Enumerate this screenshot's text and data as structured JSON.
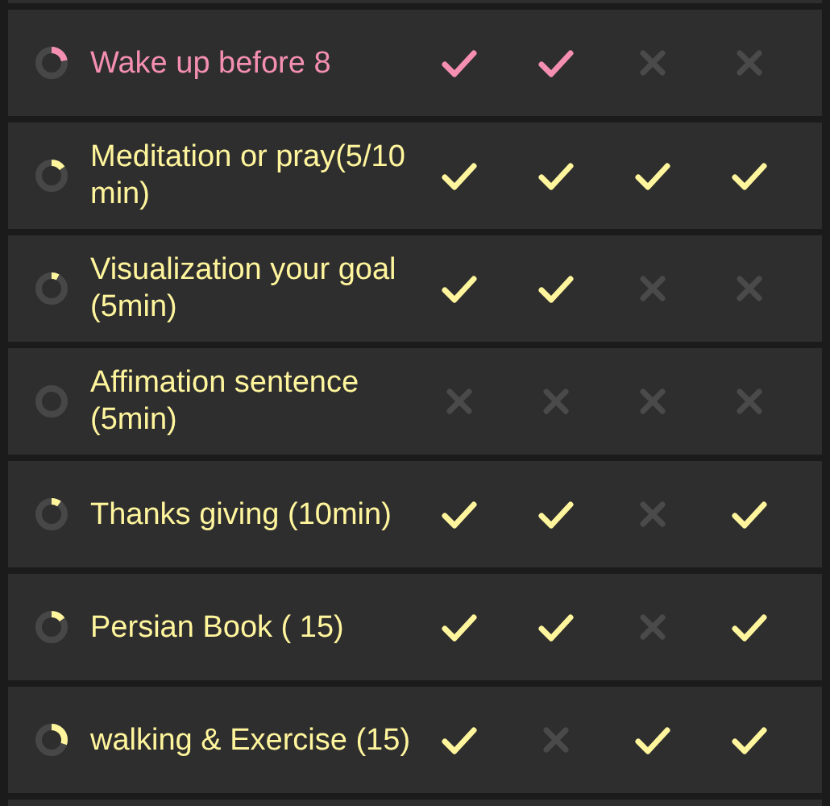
{
  "habits": [
    {
      "title": "Wake up before 8",
      "color": "#f48fb1",
      "level": 0.22,
      "days": [
        {
          "done": true
        },
        {
          "done": true
        },
        {
          "done": false
        },
        {
          "done": false
        }
      ]
    },
    {
      "title": "Meditation or pray(5/10 min)",
      "color": "#fff59d",
      "level": 0.15,
      "days": [
        {
          "done": true
        },
        {
          "done": true
        },
        {
          "done": true
        },
        {
          "done": true
        }
      ]
    },
    {
      "title": "Visualization your goal (5min)",
      "color": "#fff59d",
      "level": 0.08,
      "days": [
        {
          "done": true
        },
        {
          "done": true
        },
        {
          "done": false
        },
        {
          "done": false
        }
      ]
    },
    {
      "title": "Affimation sentence (5min)",
      "color": "#fff59d",
      "level": 0,
      "days": [
        {
          "done": false
        },
        {
          "done": false
        },
        {
          "done": false
        },
        {
          "done": false
        }
      ]
    },
    {
      "title": "Thanks giving (10min)",
      "color": "#fff59d",
      "level": 0.1,
      "days": [
        {
          "done": true
        },
        {
          "done": true
        },
        {
          "done": false
        },
        {
          "done": true
        }
      ]
    },
    {
      "title": "Persian Book ( 15)",
      "color": "#fff59d",
      "level": 0.15,
      "days": [
        {
          "done": true
        },
        {
          "done": true
        },
        {
          "done": false
        },
        {
          "done": true
        }
      ]
    },
    {
      "title": "walking & Exercise (15)",
      "color": "#fff59d",
      "level": 0.3,
      "days": [
        {
          "done": true
        },
        {
          "done": false
        },
        {
          "done": true
        },
        {
          "done": true
        }
      ]
    }
  ]
}
